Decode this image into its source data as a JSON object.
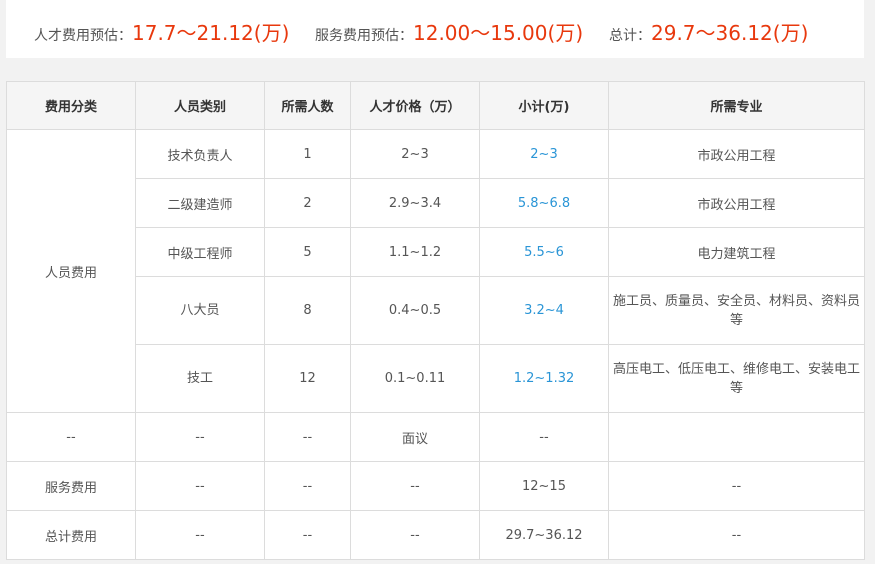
{
  "summary": {
    "talent_label": "人才费用预估：",
    "talent_value": "17.7～21.12(万)",
    "service_label": "服务费用预估：",
    "service_value": "12.00～15.00(万)",
    "total_label": "总计：",
    "total_value": "29.7～36.12(万)"
  },
  "table": {
    "headers": [
      "费用分类",
      "人员类别",
      "所需人数",
      "人才价格（万）",
      "小计(万)",
      "所需专业"
    ],
    "personnel_category": "人员费用",
    "personnel_rows": [
      {
        "type": "技术负责人",
        "count": "1",
        "price": "2~3",
        "subtotal": "2~3",
        "major": "市政公用工程"
      },
      {
        "type": "二级建造师",
        "count": "2",
        "price": "2.9~3.4",
        "subtotal": "5.8~6.8",
        "major": "市政公用工程"
      },
      {
        "type": "中级工程师",
        "count": "5",
        "price": "1.1~1.2",
        "subtotal": "5.5~6",
        "major": "电力建筑工程"
      },
      {
        "type": "八大员",
        "count": "8",
        "price": "0.4~0.5",
        "subtotal": "3.2~4",
        "major": "施工员、质量员、安全员、材料员、资料员等"
      },
      {
        "type": "技工",
        "count": "12",
        "price": "0.1~0.11",
        "subtotal": "1.2~1.32",
        "major": "高压电工、低压电工、维修电工、安装电工等"
      }
    ],
    "negotiable_row": [
      "--",
      "--",
      "--",
      "面议",
      "--",
      ""
    ],
    "service_row": [
      "服务费用",
      "--",
      "--",
      "--",
      "12~15",
      "--"
    ],
    "total_row": [
      "总计费用",
      "--",
      "--",
      "--",
      "29.7~36.12",
      "--"
    ]
  }
}
